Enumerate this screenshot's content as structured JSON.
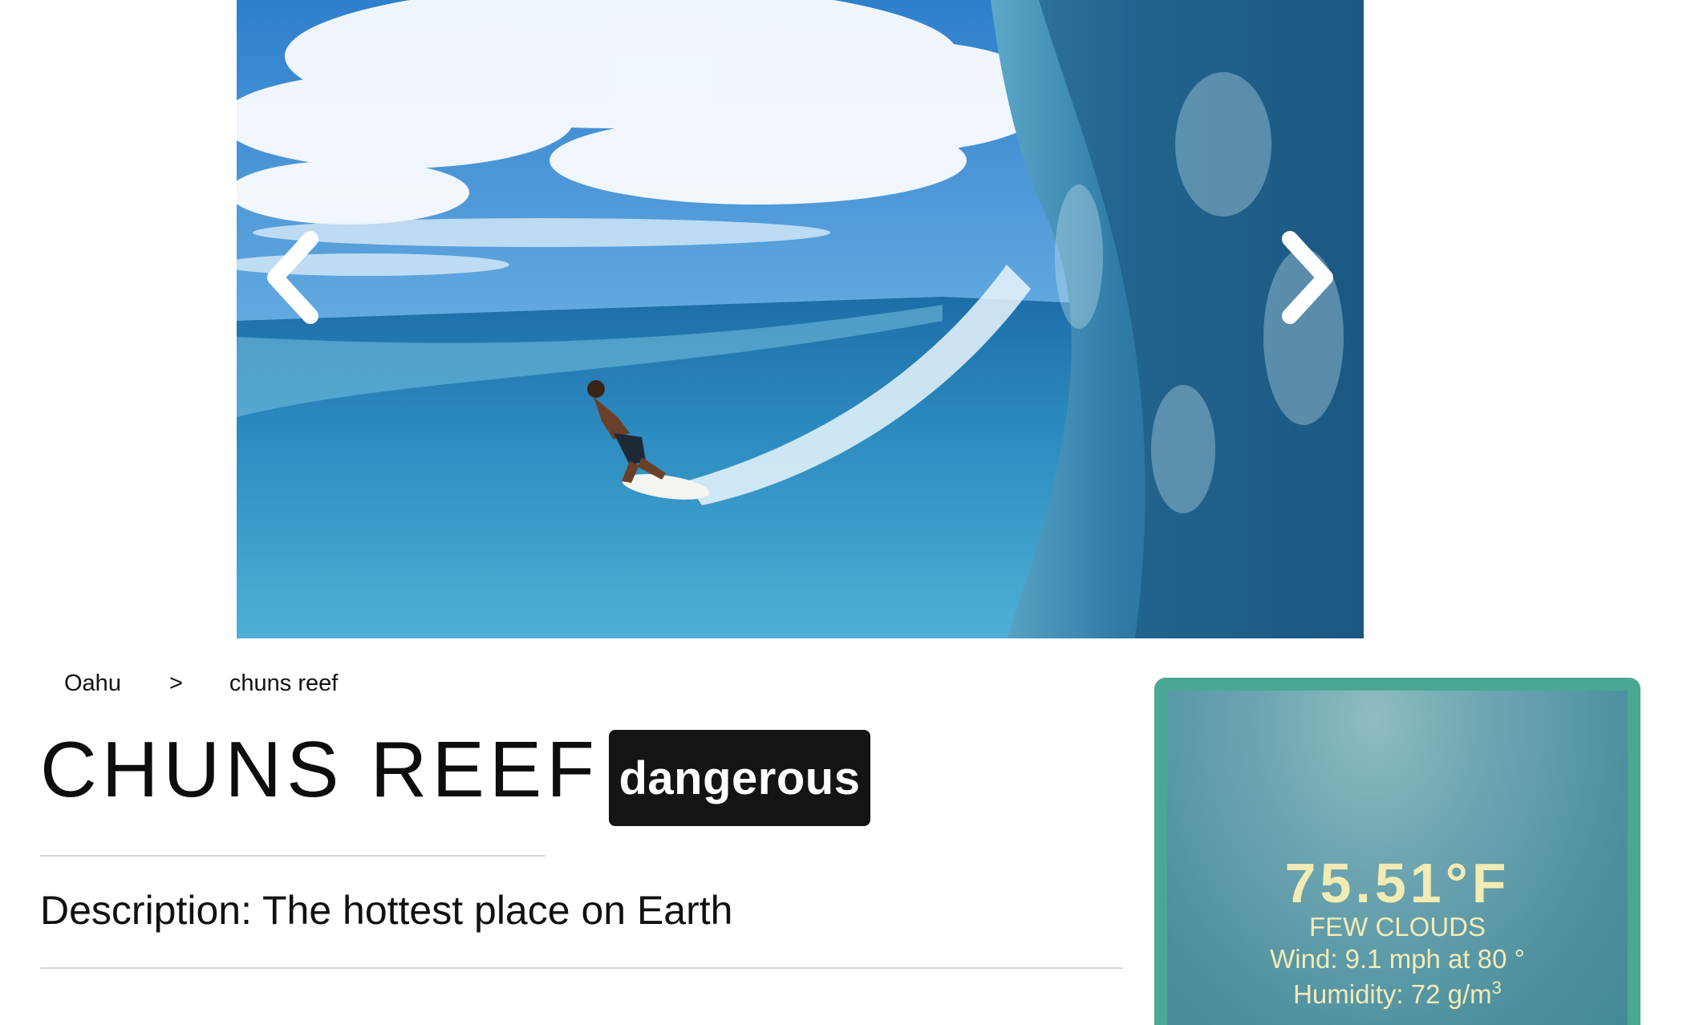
{
  "carousel": {
    "prev_icon": "chevron-left-icon",
    "next_icon": "chevron-right-icon"
  },
  "breadcrumb": {
    "parent": "Oahu",
    "separator": ">",
    "current": "chuns reef"
  },
  "spot": {
    "title": "CHUNS REEF",
    "badge": "dangerous",
    "description": "Description: The hottest place on Earth"
  },
  "weather": {
    "temperature": "75.51°F",
    "condition": "FEW CLOUDS",
    "wind": "Wind: 9.1 mph at 80 °",
    "humidity_label": "Humidity: 72 g/m",
    "humidity_exp": "3"
  },
  "colors": {
    "badge_bg": "#141414",
    "weather_border": "#4aa892",
    "weather_text": "#f3ebb4"
  }
}
